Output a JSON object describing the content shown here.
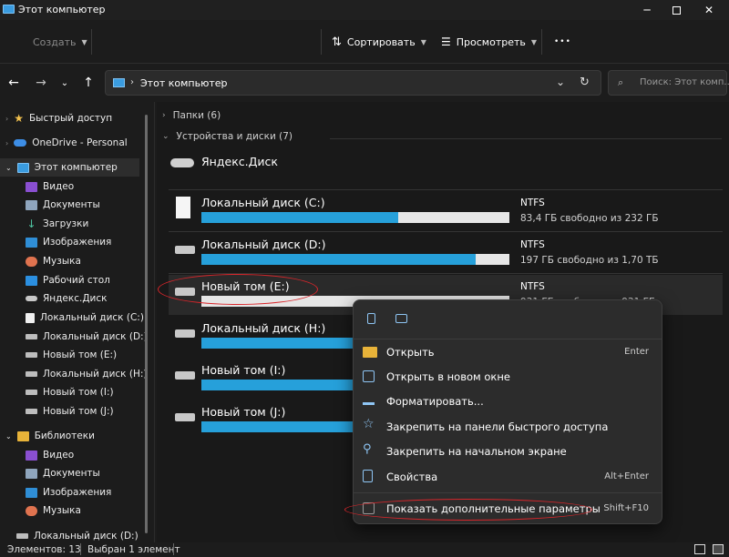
{
  "window": {
    "title": "Этот компьютер"
  },
  "toolbar": {
    "create_label": "Создать",
    "sort_label": "Сортировать",
    "view_label": "Просмотреть",
    "more_label": "•••"
  },
  "address": {
    "location": "Этот компьютер",
    "search_placeholder": "Поиск: Этот комп..."
  },
  "sidebar": {
    "items": [
      {
        "label": "Быстрый доступ"
      },
      {
        "label": "OneDrive - Personal"
      },
      {
        "label": "Этот компьютер"
      },
      {
        "label": "Видео"
      },
      {
        "label": "Документы"
      },
      {
        "label": "Загрузки"
      },
      {
        "label": "Изображения"
      },
      {
        "label": "Музыка"
      },
      {
        "label": "Рабочий стол"
      },
      {
        "label": "Яндекс.Диск"
      },
      {
        "label": "Локальный диск (C:)"
      },
      {
        "label": "Локальный диск (D:)"
      },
      {
        "label": "Новый том (E:)"
      },
      {
        "label": "Локальный диск (H:)"
      },
      {
        "label": "Новый том (I:)"
      },
      {
        "label": "Новый том (J:)"
      },
      {
        "label": "Библиотеки"
      },
      {
        "label": "Видео"
      },
      {
        "label": "Документы"
      },
      {
        "label": "Изображения"
      },
      {
        "label": "Музыка"
      },
      {
        "label": "Локальный диск (D:)"
      }
    ]
  },
  "main": {
    "folders_header": "Папки (6)",
    "devices_header": "Устройства и диски (7)",
    "yandex_label": "Яндекс.Диск",
    "drives": [
      {
        "name": "Локальный диск (C:)",
        "fs": "NTFS",
        "free": "83,4 ГБ свободно из 232 ГБ",
        "used_fraction": 0.64
      },
      {
        "name": "Локальный диск (D:)",
        "fs": "NTFS",
        "free": "197 ГБ свободно из 1,70 ТБ",
        "used_fraction": 0.89
      },
      {
        "name": "Новый том (E:)",
        "fs": "NTFS",
        "free": "931 ГБ свободно из 931 ГБ",
        "used_fraction": 0.0
      },
      {
        "name": "Локальный диск (H:)",
        "fs": "",
        "free": "",
        "used_fraction": 0.5
      },
      {
        "name": "Новый том (I:)",
        "fs": "",
        "free": "",
        "used_fraction": 0.5
      },
      {
        "name": "Новый том (J:)",
        "fs": "",
        "free": "",
        "used_fraction": 0.5
      }
    ]
  },
  "context_menu": {
    "items": [
      {
        "label": "Открыть",
        "shortcut": "Enter"
      },
      {
        "label": "Открыть в новом окне",
        "shortcut": ""
      },
      {
        "label": "Форматировать...",
        "shortcut": ""
      },
      {
        "label": "Закрепить на панели быстрого доступа",
        "shortcut": ""
      },
      {
        "label": "Закрепить на начальном экране",
        "shortcut": ""
      },
      {
        "label": "Свойства",
        "shortcut": "Alt+Enter"
      },
      {
        "label": "Показать дополнительные параметры",
        "shortcut": "Shift+F10"
      }
    ]
  },
  "status": {
    "items_count": "Элементов: 13",
    "selected": "Выбран 1 элемент"
  },
  "colors": {
    "accent": "#26a0da",
    "highlight_oval": "#d8262b"
  }
}
